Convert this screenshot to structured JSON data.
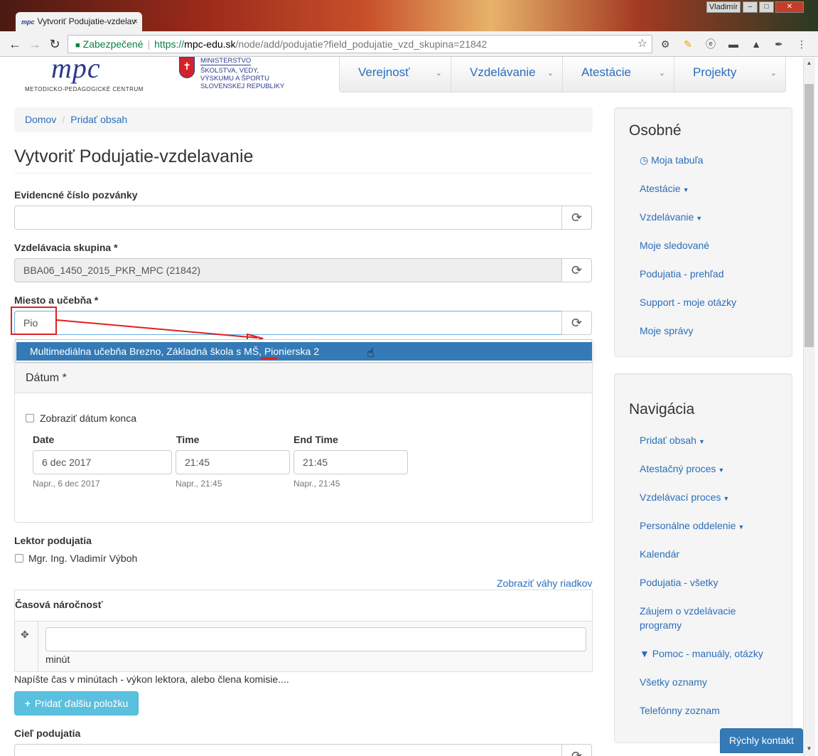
{
  "browser": {
    "tab_title": "Vytvoriť Podujatie-vzdelav",
    "tab_favicon_text": "mpc",
    "tab_close": "×",
    "user_label": "Vladimír",
    "secure_label": "Zabezpečené",
    "url_scheme": "https://",
    "url_host": "mpc-edu.sk",
    "url_path": "/node/add/podujatie?field_podujatie_vzd_skupina=21842"
  },
  "site": {
    "logo_text": "mpc",
    "logo_subtitle": "METODICKO-PEDAGOGICKÉ CENTRUM",
    "ministry_lines": [
      "MINISTERSTVO",
      "ŠKOLSTVA, VEDY,",
      "VÝSKUMU A ŠPORTU",
      "SLOVENSKEJ REPUBLIKY"
    ],
    "nav": [
      "Verejnosť",
      "Vzdelávanie",
      "Atestácie",
      "Projekty"
    ]
  },
  "breadcrumb": [
    "Domov",
    "Pridať obsah"
  ],
  "page_title": "Vytvoriť Podujatie-vzdelavanie",
  "form": {
    "evidencne_label": "Evidencné číslo pozvánky",
    "evidencne_value": "",
    "skupina_label": "Vzdelávacia skupina *",
    "skupina_value": "BBA06_1450_2015_PKR_MPC (21842)",
    "miesto_label": "Miesto a učebňa *",
    "miesto_value": "Pio",
    "autocomplete_option": "Multimediálna učebňa Brezno, Základná škola s MŠ, Pionierska 2",
    "datum_title": "Dátum *",
    "show_end_label": "Zobraziť dátum konca",
    "date_label": "Date",
    "time_label": "Time",
    "endtime_label": "End Time",
    "date_value": "6 dec 2017",
    "time_value": "21:45",
    "endtime_value": "21:45",
    "date_hint": "Napr., 6 dec 2017",
    "time_hint": "Napr., 21:45",
    "endtime_hint": "Napr., 21:45",
    "lektor_label": "Lektor podujatia",
    "lektor_option": "Mgr. Ing. Vladimír Výboh",
    "weights_link": "Zobraziť váhy riadkov",
    "casova_label": "Časová náročnosť",
    "unit_label": "minút",
    "casova_help": "Napíšte čas v minútach - výkon lektora, alebo člena komisie....",
    "add_button": "Pridať ďalšiu položku",
    "ciel_label": "Cieľ podujatia"
  },
  "sidebar": {
    "osobne_title": "Osobné",
    "osobne_links": [
      "Moja tabuľa",
      "Atestácie",
      "Vzdelávanie",
      "Moje sledované",
      "Podujatia - prehľad",
      "Support - moje otázky",
      "Moje správy"
    ],
    "navigacia_title": "Navigácia",
    "navigacia_links": [
      "Pridať obsah",
      "Atestačný proces",
      "Vzdelávací proces",
      "Personálne oddelenie",
      "Kalendár",
      "Podujatia - všetky",
      "Záujem o vzdelávacie",
      "programy",
      "Pomoc - manuály, otázky",
      "Všetky oznamy",
      "Telefónny zoznam"
    ]
  },
  "quick_contact": "Rýchly kontakt",
  "colors": {
    "link": "#2a6ebb",
    "highlight": "#337ab7",
    "annotation": "#e02020",
    "info_button": "#5bc0de"
  }
}
